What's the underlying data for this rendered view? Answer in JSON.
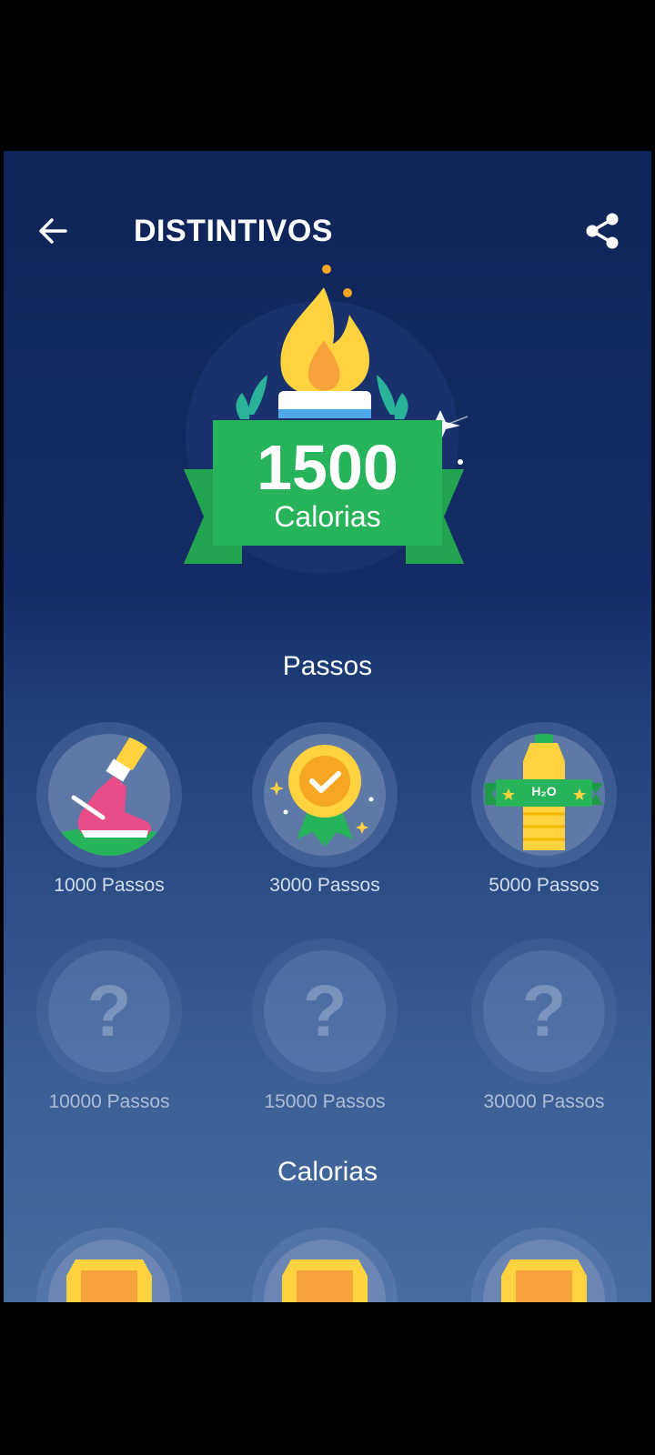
{
  "header": {
    "title": "DISTINTIVOS",
    "back_icon": "arrow-left-icon",
    "share_icon": "share-icon"
  },
  "hero": {
    "value": "1500",
    "unit": "Calorias",
    "icon": "torch-flame-icon"
  },
  "sections": [
    {
      "title": "Passos",
      "badges": [
        {
          "label": "1000 Passos",
          "icon": "sneaker-icon",
          "unlocked": true
        },
        {
          "label": "3000 Passos",
          "icon": "medal-icon",
          "unlocked": true
        },
        {
          "label": "5000 Passos",
          "icon": "water-bottle-icon",
          "unlocked": true,
          "icon_text": "H₂O"
        },
        {
          "label": "10000 Passos",
          "icon": "question-icon",
          "unlocked": false,
          "icon_text": "?"
        },
        {
          "label": "15000 Passos",
          "icon": "question-icon",
          "unlocked": false,
          "icon_text": "?"
        },
        {
          "label": "30000 Passos",
          "icon": "question-icon",
          "unlocked": false,
          "icon_text": "?"
        }
      ]
    },
    {
      "title": "Calorias"
    }
  ],
  "colors": {
    "ribbon_green": "#27b35a",
    "flame_yellow": "#ffd23f",
    "background_top": "#0f2458",
    "background_bottom": "#456b9f"
  }
}
